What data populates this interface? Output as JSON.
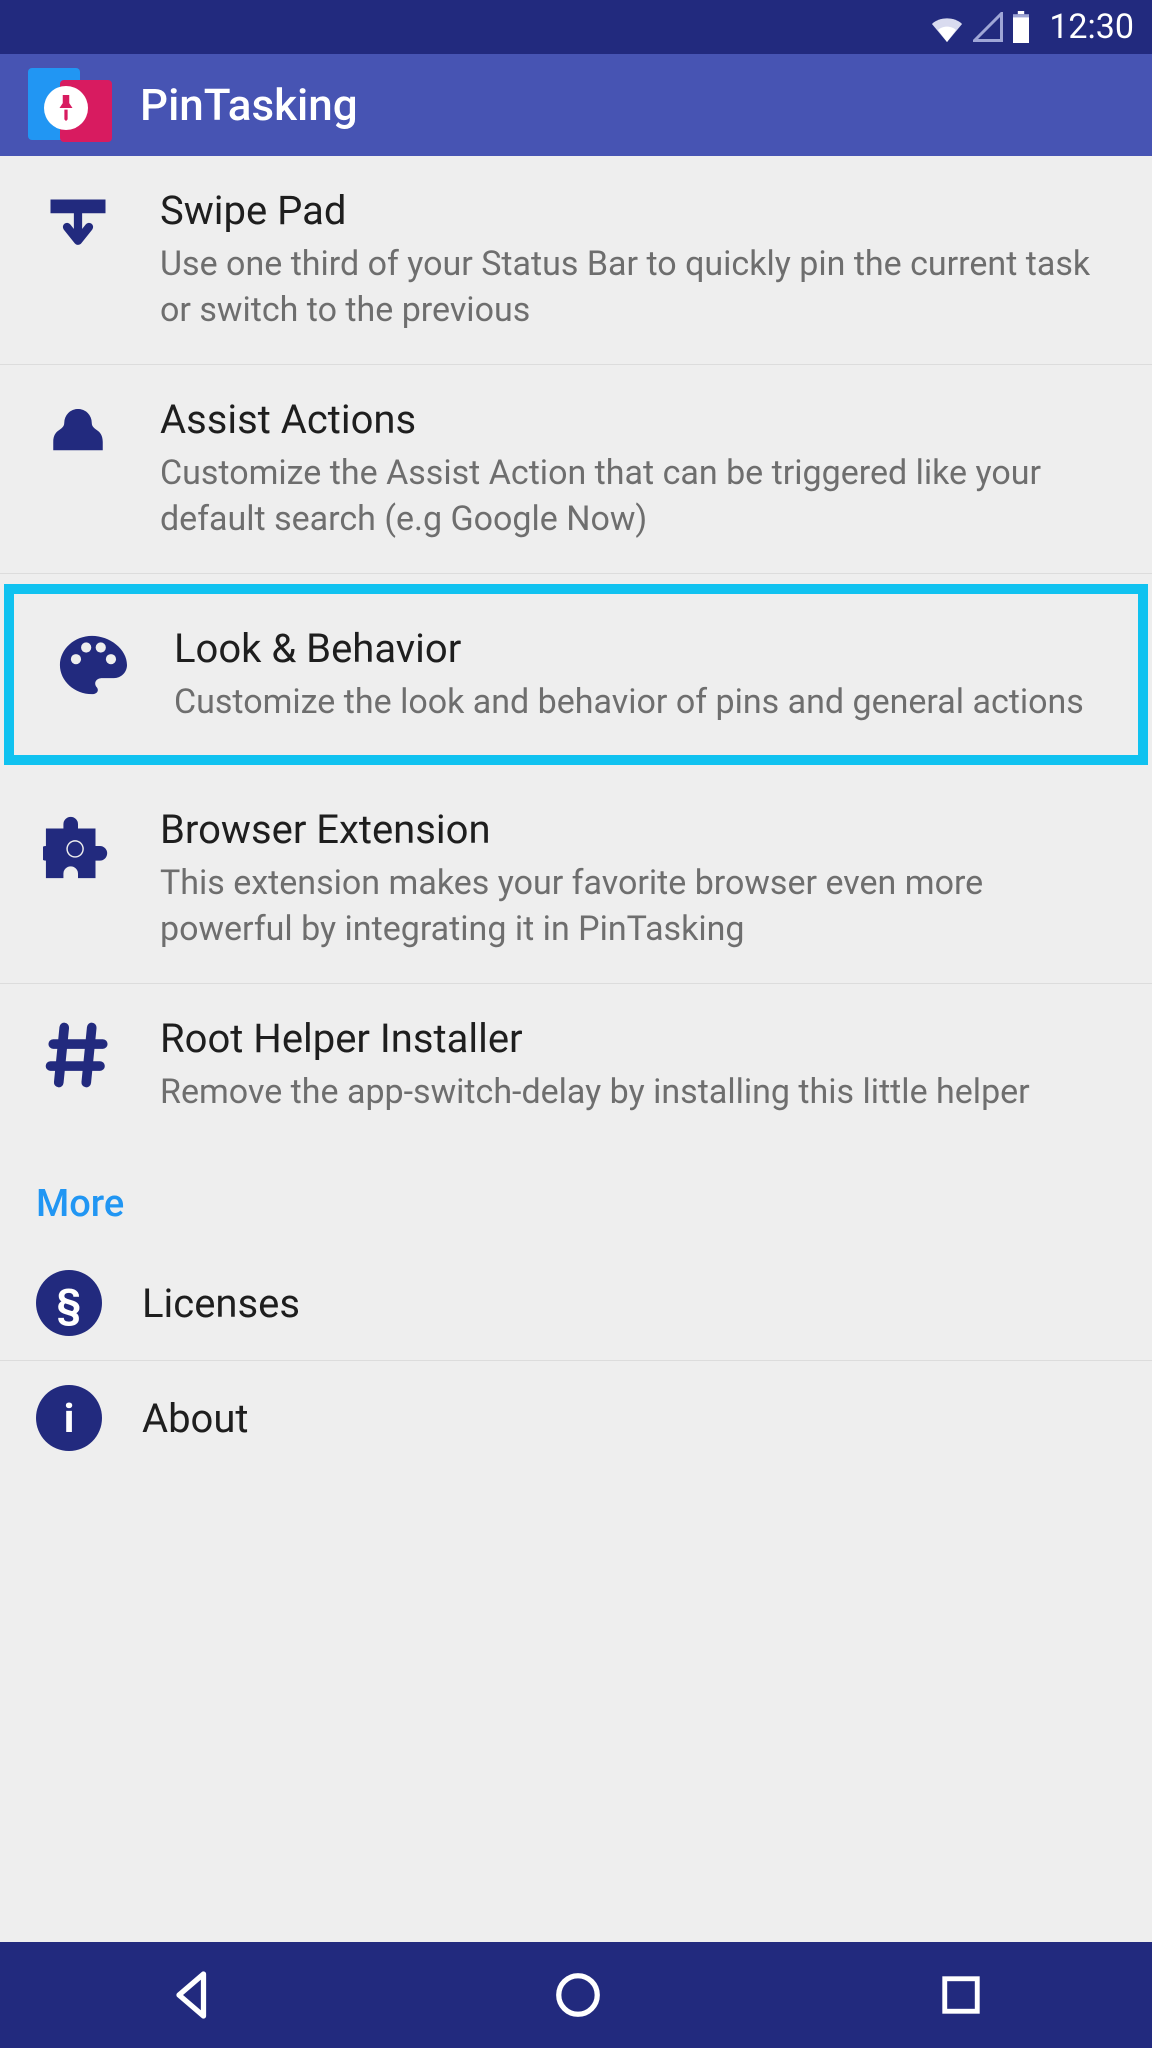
{
  "statusBar": {
    "time": "12:30"
  },
  "appBar": {
    "title": "PinTasking"
  },
  "items": [
    {
      "title": "Swipe Pad",
      "desc": "Use one third of your Status Bar to quickly pin the current task or switch to the previous"
    },
    {
      "title": "Assist Actions",
      "desc": "Customize the Assist Action that can be triggered like your default search (e.g Google Now)"
    },
    {
      "title": "Look & Behavior",
      "desc": "Customize the look and behavior of pins and general actions"
    },
    {
      "title": "Browser Extension",
      "desc": "This extension makes your favorite browser even more powerful by integrating it in PinTasking"
    },
    {
      "title": "Root Helper Installer",
      "desc": "Remove the app-switch-delay by installing this little helper"
    }
  ],
  "sectionMore": {
    "label": "More"
  },
  "moreItems": [
    {
      "label": "Licenses",
      "symbol": "§"
    },
    {
      "label": "About",
      "symbol": "i"
    }
  ]
}
